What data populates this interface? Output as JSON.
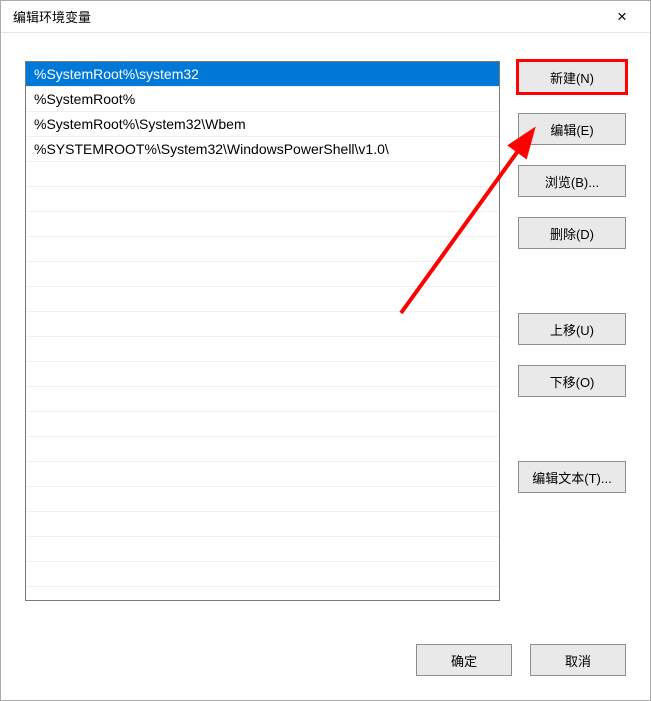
{
  "titlebar": {
    "title": "编辑环境变量",
    "close": "×"
  },
  "list": {
    "items": [
      {
        "label": "%SystemRoot%\\system32",
        "selected": true
      },
      {
        "label": "%SystemRoot%",
        "selected": false
      },
      {
        "label": "%SystemRoot%\\System32\\Wbem",
        "selected": false
      },
      {
        "label": "%SYSTEMROOT%\\System32\\WindowsPowerShell\\v1.0\\",
        "selected": false
      }
    ]
  },
  "buttons": {
    "new": "新建(N)",
    "edit": "编辑(E)",
    "browse": "浏览(B)...",
    "delete": "删除(D)",
    "moveUp": "上移(U)",
    "moveDown": "下移(O)",
    "editText": "编辑文本(T)...",
    "ok": "确定",
    "cancel": "取消"
  }
}
